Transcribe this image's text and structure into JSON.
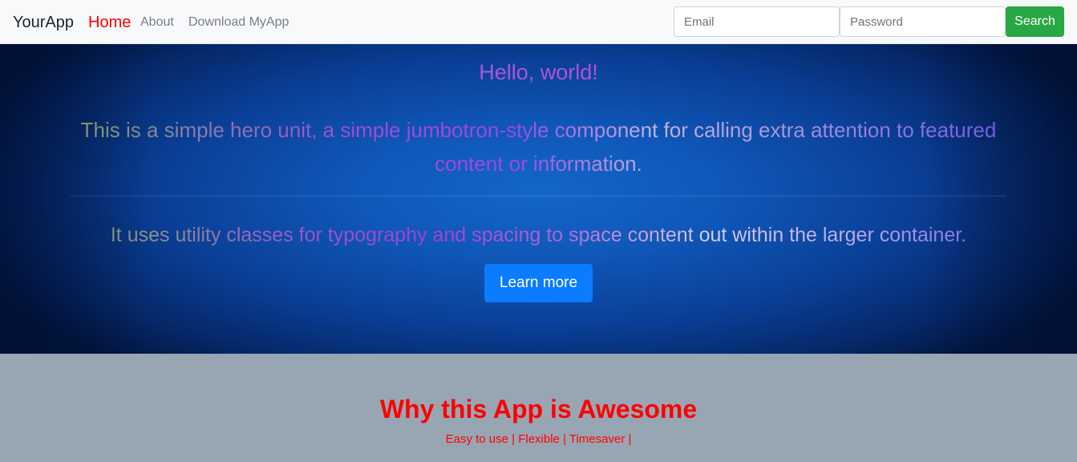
{
  "navbar": {
    "brand": "YourApp",
    "links": [
      {
        "label": "Home",
        "active": true
      },
      {
        "label": "About"
      },
      {
        "label": "Download MyApp"
      }
    ],
    "email_placeholder": "Email",
    "password_placeholder": "Password",
    "search_label": "Search"
  },
  "hero": {
    "title": "Hello, world!",
    "lead": "This is a simple hero unit, a simple jumbotron-style component for calling extra attention to featured content or information.",
    "text": "It uses utility classes for typography and spacing to space content out within the larger container.",
    "button_label": "Learn more"
  },
  "features": {
    "title": "Why this App is Awesome",
    "list": "Easy to use | Flexible | Timesaver |"
  },
  "colors": {
    "navbar_bg": "#f8f9fa",
    "active_link": "#ff0000",
    "search_button": "#28a745",
    "learn_button": "#0b7bff",
    "features_bg": "#98a6b4",
    "features_text": "#ff0000"
  }
}
